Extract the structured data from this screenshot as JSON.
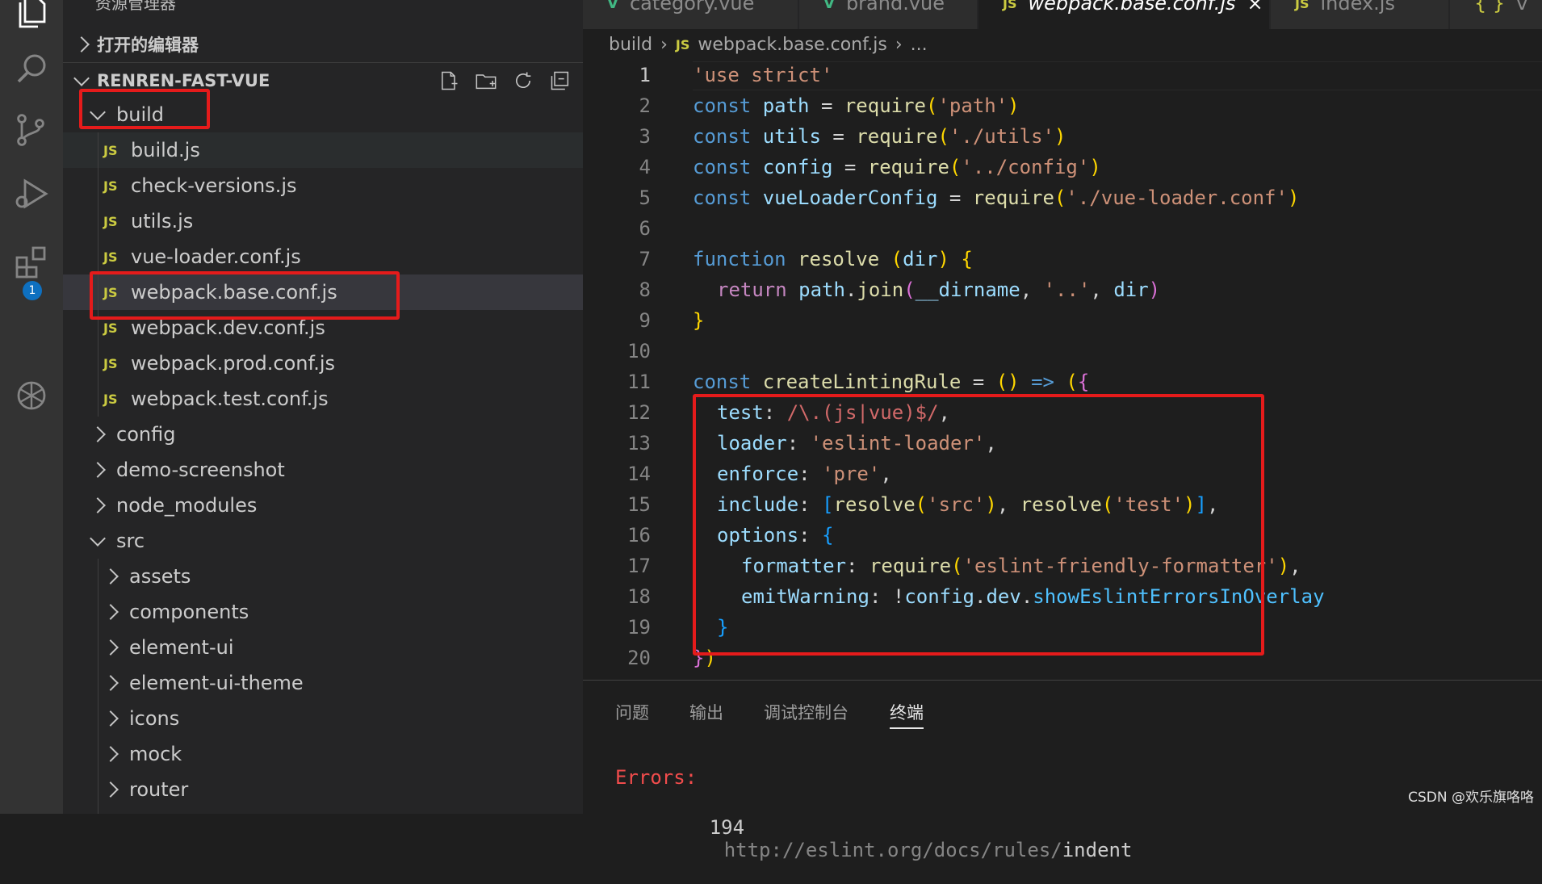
{
  "sidebar": {
    "top_title": "资源管理器",
    "open_editors": "打开的编辑器",
    "project": "RENREN-FAST-VUE",
    "tree": [
      {
        "label": "build",
        "type": "folder-open"
      },
      {
        "label": "build.js",
        "type": "js"
      },
      {
        "label": "check-versions.js",
        "type": "js"
      },
      {
        "label": "utils.js",
        "type": "js"
      },
      {
        "label": "vue-loader.conf.js",
        "type": "js"
      },
      {
        "label": "webpack.base.conf.js",
        "type": "js"
      },
      {
        "label": "webpack.dev.conf.js",
        "type": "js"
      },
      {
        "label": "webpack.prod.conf.js",
        "type": "js"
      },
      {
        "label": "webpack.test.conf.js",
        "type": "js"
      },
      {
        "label": "config",
        "type": "folder"
      },
      {
        "label": "demo-screenshot",
        "type": "folder"
      },
      {
        "label": "node_modules",
        "type": "folder"
      },
      {
        "label": "src",
        "type": "folder-open"
      },
      {
        "label": "assets",
        "type": "folder"
      },
      {
        "label": "components",
        "type": "folder"
      },
      {
        "label": "element-ui",
        "type": "folder"
      },
      {
        "label": "element-ui-theme",
        "type": "folder"
      },
      {
        "label": "icons",
        "type": "folder"
      },
      {
        "label": "mock",
        "type": "folder"
      },
      {
        "label": "router",
        "type": "folder"
      }
    ],
    "js_badge": "JS"
  },
  "activity": {
    "extensions_badge": "1"
  },
  "tabs": [
    {
      "label": "category.vue",
      "icon": "V"
    },
    {
      "label": "brand.vue",
      "icon": "V"
    },
    {
      "label": "webpack.base.conf.js",
      "icon": "JS",
      "close": "×"
    },
    {
      "label": "index.js",
      "icon": "JS"
    },
    {
      "label": "v",
      "icon": "{ }"
    }
  ],
  "breadcrumb": {
    "folder": "build",
    "file": "webpack.base.conf.js",
    "more": "...",
    "icon": "JS"
  },
  "code": {
    "line_numbers": [
      "1",
      "2",
      "3",
      "4",
      "5",
      "6",
      "7",
      "8",
      "9",
      "10",
      "11",
      "12",
      "13",
      "14",
      "15",
      "16",
      "17",
      "18",
      "19",
      "20"
    ],
    "l1": "'use strict'",
    "l2": [
      "const",
      " path",
      " = ",
      "require",
      "(",
      "'path'",
      ")"
    ],
    "l3": [
      "const",
      " utils",
      " = ",
      "require",
      "(",
      "'./utils'",
      ")"
    ],
    "l4": [
      "const",
      " config",
      " = ",
      "require",
      "(",
      "'../config'",
      ")"
    ],
    "l5": [
      "const",
      " vueLoaderConfig",
      " = ",
      "require",
      "(",
      "'./vue-loader.conf'",
      ")"
    ],
    "l7": [
      "function",
      " resolve",
      " ",
      "(",
      "dir",
      ")",
      " ",
      "{"
    ],
    "l8": [
      "return",
      " path",
      ".",
      "join",
      "(",
      "__dirname",
      ", ",
      "'..'",
      ", ",
      "dir",
      ")"
    ],
    "l9": "}",
    "l11": [
      "const",
      " createLintingRule",
      " = ",
      "()",
      " ",
      "=>",
      " ",
      "(",
      "{"
    ],
    "l12": [
      "test",
      ": ",
      "/\\.(js|vue)$/",
      ","
    ],
    "l13": [
      "loader",
      ": ",
      "'eslint-loader'",
      ","
    ],
    "l14": [
      "enforce",
      ": ",
      "'pre'",
      ","
    ],
    "l15": [
      "include",
      ": ",
      "[",
      "resolve",
      "(",
      "'src'",
      ")",
      ", ",
      "resolve",
      "(",
      "'test'",
      ")",
      "]",
      ","
    ],
    "l16": [
      "options",
      ": ",
      "{"
    ],
    "l17": [
      "formatter",
      ": ",
      "require",
      "(",
      "'eslint-friendly-formatter'",
      ")",
      ","
    ],
    "l18": [
      "emitWarning",
      ": ",
      "!",
      "config",
      ".",
      "dev",
      ".",
      "showEslintErrorsInOverlay"
    ],
    "l19": "}",
    "l20": [
      "}",
      ")"
    ]
  },
  "panel": {
    "tabs": [
      "问题",
      "输出",
      "调试控制台",
      "终端"
    ],
    "errors_label": "Errors:",
    "err_count": "194",
    "err_url": "http://eslint.org/docs/rules/",
    "err_rule": "indent"
  },
  "watermark": "CSDN @欢乐旗咯咯"
}
